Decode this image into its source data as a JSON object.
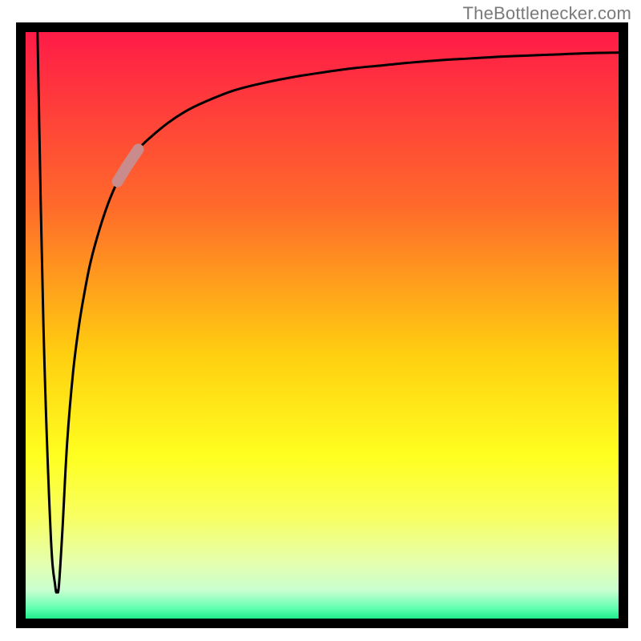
{
  "attribution": "TheBottlenecker.com",
  "chart_data": {
    "type": "line",
    "title": "",
    "xlabel": "",
    "ylabel": "",
    "xlim": [
      0,
      100
    ],
    "ylim": [
      0,
      100
    ],
    "grid": false,
    "background_gradient_stops": [
      {
        "offset": 0.0,
        "color": "#ff1948"
      },
      {
        "offset": 0.3,
        "color": "#ff6a2a"
      },
      {
        "offset": 0.55,
        "color": "#ffcf10"
      },
      {
        "offset": 0.72,
        "color": "#ffff20"
      },
      {
        "offset": 0.82,
        "color": "#f8ff60"
      },
      {
        "offset": 0.9,
        "color": "#e4ffb0"
      },
      {
        "offset": 0.945,
        "color": "#c8ffd0"
      },
      {
        "offset": 0.975,
        "color": "#60ffb0"
      },
      {
        "offset": 1.0,
        "color": "#00e47a"
      }
    ],
    "series": [
      {
        "name": "bottleneck-curve",
        "color": "#000000",
        "x": [
          2.0,
          3.0,
          4.2,
          5.0,
          5.3,
          5.6,
          6.2,
          7.0,
          8.0,
          9.0,
          10.0,
          11.0,
          12.5,
          14.0,
          15.5,
          17.0,
          19.0,
          21.0,
          24.0,
          27.0,
          30.0,
          35.0,
          40.0,
          45.0,
          50.0,
          55.0,
          60.0,
          65.0,
          70.0,
          75.0,
          80.0,
          85.0,
          90.0,
          95.0,
          100.0
        ],
        "values": [
          100,
          50,
          15,
          5.5,
          4.8,
          5.5,
          15,
          30,
          42,
          50,
          56,
          61,
          66.5,
          71,
          74.5,
          77,
          80,
          82,
          84.5,
          86.5,
          88,
          90,
          91.3,
          92.3,
          93.1,
          93.8,
          94.3,
          94.8,
          95.2,
          95.5,
          95.8,
          96.0,
          96.2,
          96.4,
          96.5
        ]
      }
    ],
    "highlight": {
      "name": "highlight-segment",
      "color": "#c98b8b",
      "x_range": [
        15.5,
        19.0
      ]
    }
  }
}
